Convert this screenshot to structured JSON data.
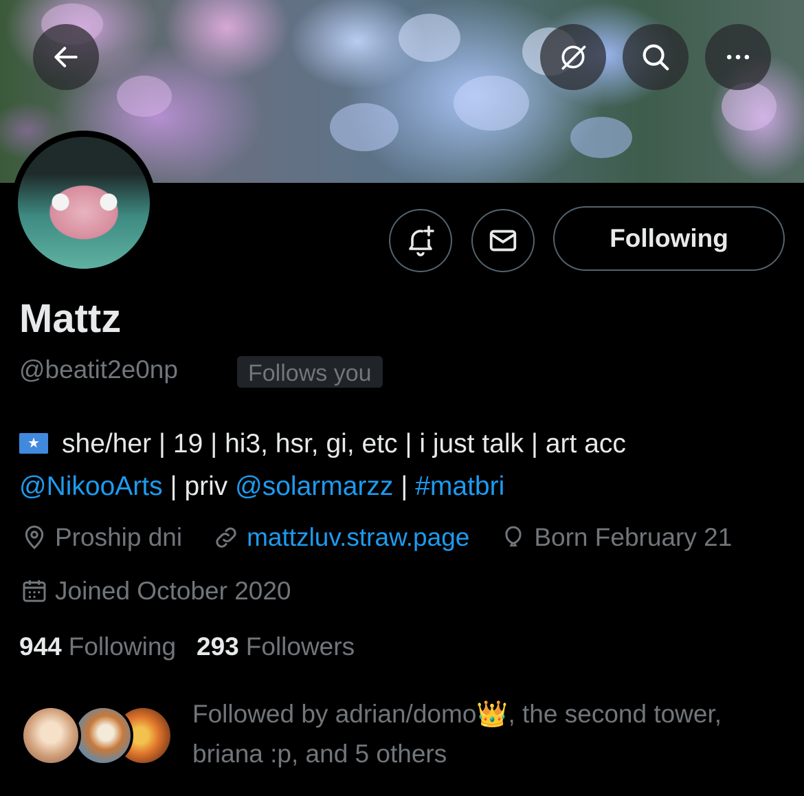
{
  "header": {
    "back_icon": "arrow-left-icon",
    "grok_icon": "grok-icon",
    "search_icon": "search-icon",
    "more_icon": "more-horizontal-icon"
  },
  "profile": {
    "name": "Mattz",
    "handle": "@beatit2e0np",
    "follows_you": "Follows you",
    "following_button": "Following",
    "notify_icon": "bell-plus-icon",
    "message_icon": "mail-icon"
  },
  "bio": {
    "flag": "Somalia flag",
    "text1": "she/her | 19 | hi3, hsr, gi, etc | i just talk | art acc",
    "mention1": "@NikooArts",
    "text2": " | priv ",
    "mention2": "@solarmarzz",
    "text3": " | ",
    "hashtag": "#matbri"
  },
  "meta": {
    "location": "Proship dni",
    "website": "mattzluv.straw.page",
    "birthday": "Born February 21",
    "joined": "Joined October 2020"
  },
  "stats": {
    "following_count": "944",
    "following_label": "Following",
    "followers_count": "293",
    "followers_label": "Followers"
  },
  "followed_by": {
    "line1": "Followed by adrian/domo👑, the second tower,",
    "line2": "briana :p, and 5 others"
  },
  "colors": {
    "background": "#000000",
    "text": "#e7e9ea",
    "secondary": "#71767b",
    "link": "#1d9bf0",
    "border": "#536471"
  }
}
